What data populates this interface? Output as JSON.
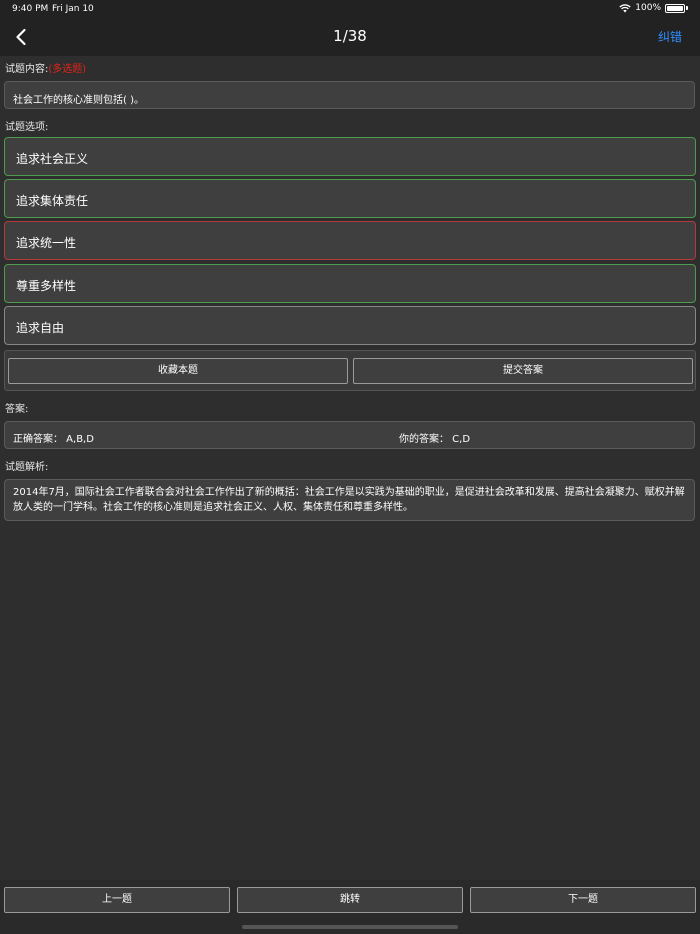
{
  "status_bar": {
    "time": "9:40 PM",
    "date": "Fri Jan 10",
    "battery": "100%"
  },
  "nav": {
    "title": "1/38",
    "report_label": "纠错"
  },
  "question": {
    "label": "试题内容:",
    "type_tag": "(多选题)",
    "text": "社会工作的核心准则包括(   )。"
  },
  "options_label": "试题选项:",
  "options": [
    {
      "text": "追求社会正义",
      "state": "green"
    },
    {
      "text": "追求集体责任",
      "state": "green"
    },
    {
      "text": "追求统一性",
      "state": "red"
    },
    {
      "text": "尊重多样性",
      "state": "green"
    },
    {
      "text": "追求自由",
      "state": "gray"
    }
  ],
  "actions": {
    "favorite_label": "收藏本题",
    "submit_label": "提交答案"
  },
  "answer": {
    "label": "答案:",
    "correct_text": "正确答案： A,B,D",
    "yours_text": "你的答案： C,D"
  },
  "analysis": {
    "label": "试题解析:",
    "text": "2014年7月，国际社会工作者联合会对社会工作作出了新的概括：社会工作是以实践为基础的职业，是促进社会改革和发展、提高社会凝聚力、赋权并解放人类的一门学科。社会工作的核心准则是追求社会正义、人权、集体责任和尊重多样性。"
  },
  "bottom_nav": {
    "prev_label": "上一题",
    "jump_label": "跳转",
    "next_label": "下一题"
  },
  "colors": {
    "accent": "#2f8fff",
    "correct_border": "#4e9a4e",
    "wrong_border": "#b23a3a",
    "tag_red": "#e0241b"
  }
}
